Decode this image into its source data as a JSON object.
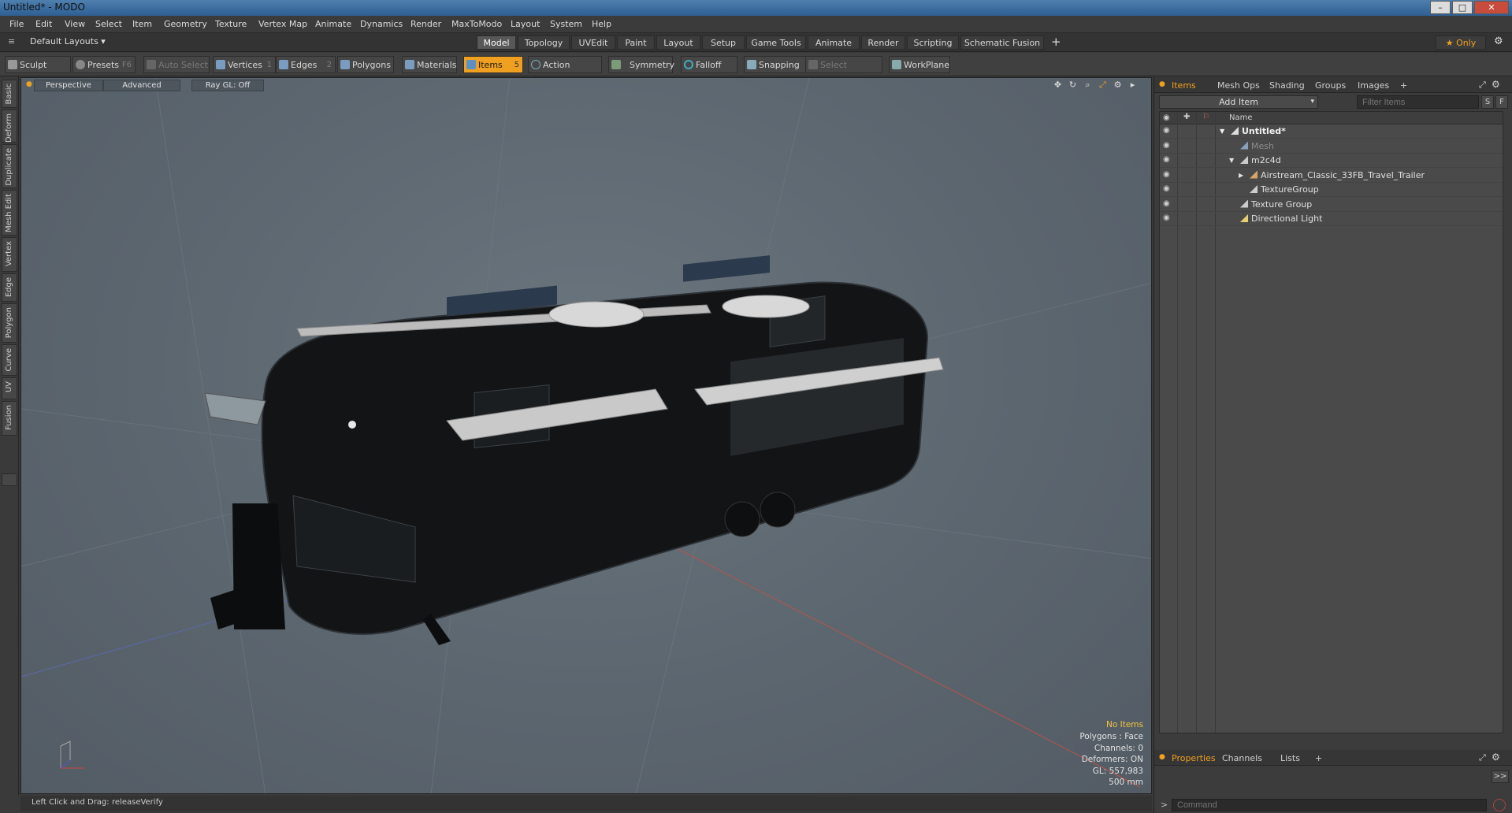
{
  "window": {
    "title": "Untitled* - MODO",
    "controls": [
      "–",
      "□",
      "✕"
    ]
  },
  "menus": [
    "File",
    "Edit",
    "View",
    "Select",
    "Item",
    "Geometry",
    "Texture",
    "Vertex Map",
    "Animate",
    "Dynamics",
    "Render",
    "MaxToModo",
    "Layout",
    "System",
    "Help"
  ],
  "layout_row": {
    "default_layouts": "Default Layouts ▾",
    "tabs": [
      "Model",
      "Topology",
      "UVEdit",
      "Paint",
      "Layout",
      "Setup",
      "Game Tools",
      "Animate",
      "Render",
      "Scripting",
      "Schematic Fusion"
    ],
    "active_tab": "Model",
    "add": "+",
    "only": "★ Only",
    "gear": "⚙"
  },
  "toolbar": {
    "sculpt": "Sculpt",
    "presets": "Presets",
    "presets_key": "F6",
    "auto_select": "Auto Select",
    "vertices": "Vertices",
    "vertices_key": "1",
    "edges": "Edges",
    "edges_key": "2",
    "polygons": "Polygons",
    "materials": "Materials",
    "items": "Items",
    "items_key": "5",
    "action_center": "Action Center",
    "symmetry": "Symmetry",
    "falloff": "Falloff",
    "snapping": "Snapping",
    "select_through": "Select Through",
    "workplane": "WorkPlane"
  },
  "left_tabs": [
    "Basic",
    "Deform",
    "Duplicate",
    "Mesh Edit",
    "Vertex",
    "Edge",
    "Polygon",
    "Curve",
    "UV",
    "Fusion"
  ],
  "viewport": {
    "view": "Perspective",
    "shading": "Advanced",
    "raygl": "Ray GL: Off",
    "stats": {
      "selection": "No Items",
      "polygons": "Polygons : Face",
      "channels": "Channels: 0",
      "deformers": "Deformers: ON",
      "gl": "GL: 557,983",
      "scale": "500 mm"
    }
  },
  "status": {
    "hint": "Left Click and Drag:",
    "action": "releaseVerify"
  },
  "items_panel": {
    "tabs": [
      "Items",
      "Mesh Ops",
      "Shading",
      "Groups",
      "Images",
      "+"
    ],
    "active_tab": "Items",
    "add_item": "Add Item",
    "filter_placeholder": "Filter Items",
    "s_btn": "S",
    "f_btn": "F",
    "column_name": "Name",
    "items": [
      {
        "label": "Untitled*",
        "indent": 0,
        "arrow": "▼",
        "style": "bold",
        "icon": "scene-icon"
      },
      {
        "label": "Mesh",
        "indent": 1,
        "arrow": "",
        "style": "dim",
        "icon": "mesh-icon"
      },
      {
        "label": "m2c4d",
        "indent": 1,
        "arrow": "▼",
        "style": "normal",
        "icon": "group-icon"
      },
      {
        "label": "Airstream_Classic_33FB_Travel_Trailer",
        "indent": 2,
        "arrow": "▶",
        "style": "normal",
        "icon": "locator-icon"
      },
      {
        "label": "TextureGroup",
        "indent": 2,
        "arrow": "",
        "style": "normal",
        "icon": "group-icon"
      },
      {
        "label": "Texture Group",
        "indent": 1,
        "arrow": "",
        "style": "normal",
        "icon": "group-icon"
      },
      {
        "label": "Directional Light",
        "indent": 1,
        "arrow": "",
        "style": "normal",
        "icon": "light-icon"
      }
    ]
  },
  "properties_panel": {
    "tabs": [
      "Properties",
      "Channels",
      "Lists",
      "+"
    ],
    "active_tab": "Properties",
    "expand": ">>",
    "command_prompt": ">",
    "command_placeholder": "Command"
  },
  "colors": {
    "accent": "#f0a020",
    "highlight_text": "#f2c23c"
  }
}
